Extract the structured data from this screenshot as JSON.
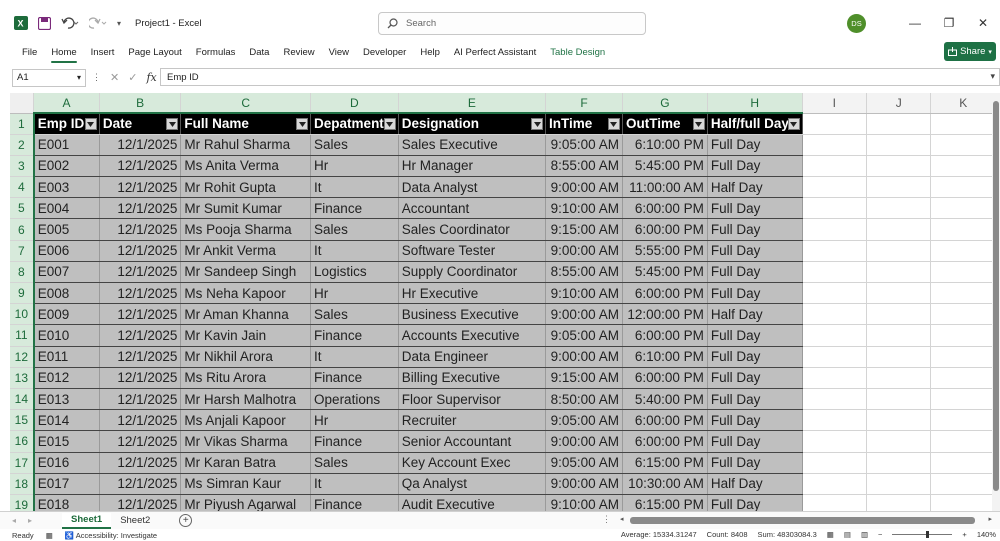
{
  "app": {
    "title": "Project1  -  Excel",
    "user_initials": "DS",
    "search_placeholder": "Search",
    "brand_color": "#217346",
    "share_label": "Share"
  },
  "menu": {
    "items": [
      "File",
      "Home",
      "Insert",
      "Page Layout",
      "Formulas",
      "Data",
      "Review",
      "View",
      "Developer",
      "Help",
      "AI Perfect Assistant",
      "Table Design"
    ],
    "active": "Home",
    "contextual": "Table Design"
  },
  "formula_bar": {
    "name_box": "A1",
    "content": "Emp ID"
  },
  "sheet": {
    "columns": [
      "A",
      "B",
      "C",
      "D",
      "E",
      "F",
      "G",
      "H",
      "I",
      "J",
      "K"
    ],
    "headers": [
      "Emp ID",
      "Date",
      "Full Name",
      "Depatment",
      "Designation",
      "InTime",
      "OutTime",
      "Half/full Day"
    ],
    "rows": [
      [
        "E001",
        "12/1/2025",
        "Mr Rahul Sharma",
        "Sales",
        "Sales Executive",
        "9:05:00 AM",
        "6:10:00 PM",
        "Full Day"
      ],
      [
        "E002",
        "12/1/2025",
        "Ms Anita Verma",
        "Hr",
        "Hr Manager",
        "8:55:00 AM",
        "5:45:00 PM",
        "Full Day"
      ],
      [
        "E003",
        "12/1/2025",
        "Mr Rohit Gupta",
        "It",
        "Data Analyst",
        "9:00:00 AM",
        "11:00:00 AM",
        "Half Day"
      ],
      [
        "E004",
        "12/1/2025",
        "Mr Sumit Kumar",
        "Finance",
        "Accountant",
        "9:10:00 AM",
        "6:00:00 PM",
        "Full Day"
      ],
      [
        "E005",
        "12/1/2025",
        "Ms Pooja Sharma",
        "Sales",
        "Sales Coordinator",
        "9:15:00 AM",
        "6:00:00 PM",
        "Full Day"
      ],
      [
        "E006",
        "12/1/2025",
        "Mr Ankit Verma",
        "It",
        "Software Tester",
        "9:00:00 AM",
        "5:55:00 PM",
        "Full Day"
      ],
      [
        "E007",
        "12/1/2025",
        "Mr Sandeep Singh",
        "Logistics",
        "Supply Coordinator",
        "8:55:00 AM",
        "5:45:00 PM",
        "Full Day"
      ],
      [
        "E008",
        "12/1/2025",
        "Ms Neha Kapoor",
        "Hr",
        "Hr Executive",
        "9:10:00 AM",
        "6:00:00 PM",
        "Full Day"
      ],
      [
        "E009",
        "12/1/2025",
        "Mr Aman Khanna",
        "Sales",
        "Business Executive",
        "9:00:00 AM",
        "12:00:00 PM",
        "Half Day"
      ],
      [
        "E010",
        "12/1/2025",
        "Mr Kavin Jain",
        "Finance",
        "Accounts Executive",
        "9:05:00 AM",
        "6:00:00 PM",
        "Full Day"
      ],
      [
        "E011",
        "12/1/2025",
        "Mr Nikhil Arora",
        "It",
        "Data Engineer",
        "9:00:00 AM",
        "6:10:00 PM",
        "Full Day"
      ],
      [
        "E012",
        "12/1/2025",
        "Ms Ritu Arora",
        "Finance",
        "Billing Executive",
        "9:15:00 AM",
        "6:00:00 PM",
        "Full Day"
      ],
      [
        "E013",
        "12/1/2025",
        "Mr Harsh Malhotra",
        "Operations",
        "Floor Supervisor",
        "8:50:00 AM",
        "5:40:00 PM",
        "Full Day"
      ],
      [
        "E014",
        "12/1/2025",
        "Ms Anjali Kapoor",
        "Hr",
        "Recruiter",
        "9:05:00 AM",
        "6:00:00 PM",
        "Full Day"
      ],
      [
        "E015",
        "12/1/2025",
        "Mr Vikas Sharma",
        "Finance",
        "Senior Accountant",
        "9:00:00 AM",
        "6:00:00 PM",
        "Full Day"
      ],
      [
        "E016",
        "12/1/2025",
        "Mr Karan Batra",
        "Sales",
        "Key Account Exec",
        "9:05:00 AM",
        "6:15:00 PM",
        "Full Day"
      ],
      [
        "E017",
        "12/1/2025",
        "Ms Simran Kaur",
        "It",
        "Qa Analyst",
        "9:00:00 AM",
        "10:30:00 AM",
        "Half Day"
      ],
      [
        "E018",
        "12/1/2025",
        "Mr Piyush Agarwal",
        "Finance",
        "Audit Executive",
        "9:10:00 AM",
        "6:15:00 PM",
        "Full Day"
      ]
    ]
  },
  "sheet_tabs": [
    "Sheet1",
    "Sheet2"
  ],
  "status": {
    "ready": "Ready",
    "accessibility": "Accessibility: Investigate",
    "average": "Average: 15334.31247",
    "count": "Count: 8408",
    "sum": "Sum: 48303084.3",
    "zoom": "140%"
  }
}
